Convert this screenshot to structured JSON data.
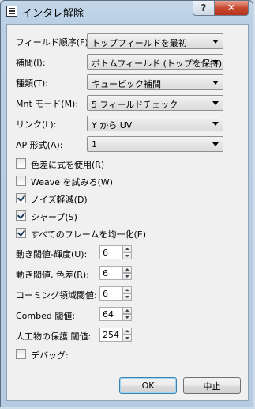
{
  "window": {
    "title": "インタレ解除"
  },
  "titlebar": {
    "help_label": "?",
    "close_label": "✕"
  },
  "fields": [
    {
      "label": "フィールド順序(F):",
      "value": "トップフィールドを最初"
    },
    {
      "label": "補間(I):",
      "value": "ボトムフィールド (トップを保持)"
    },
    {
      "label": "種類(T):",
      "value": "キュービック補間"
    },
    {
      "label": "Mnt モード(M):",
      "value": "5 フィールドチェック"
    },
    {
      "label": "リンク(L):",
      "value": "Y から UV"
    },
    {
      "label": "AP 形式(A):",
      "value": "1"
    }
  ],
  "checkboxes": [
    {
      "label": "色差に式を使用(R)",
      "checked": false
    },
    {
      "label": "Weave を試みる(W)",
      "checked": false
    },
    {
      "label": "ノイズ軽減(D)",
      "checked": true
    },
    {
      "label": "シャープ(S)",
      "checked": true
    },
    {
      "label": "すべてのフレームを均一化(E)",
      "checked": true
    }
  ],
  "spinners": [
    {
      "label": "動き閾値-輝度(U):",
      "value": "6"
    },
    {
      "label": "動き閾値, 色差(R):",
      "value": "6"
    },
    {
      "label": "コーミング領域閾値:",
      "value": "6"
    },
    {
      "label": "Combed 閾値:",
      "value": "64"
    },
    {
      "label": "人工物の保護 閾値:",
      "value": "254"
    }
  ],
  "debug": {
    "label": "デバッグ:",
    "checked": false
  },
  "buttons": {
    "ok": "OK",
    "cancel": "中止"
  }
}
